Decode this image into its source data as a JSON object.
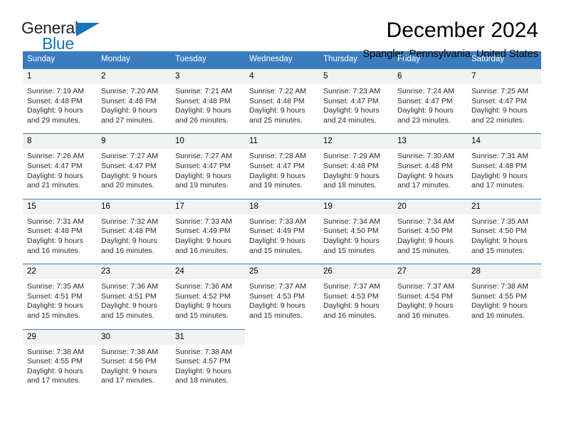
{
  "logo": {
    "word_one": "General",
    "word_two": "Blue",
    "triangle_color": "#1574bb"
  },
  "header": {
    "title": "December 2024",
    "location": "Spangler, Pennsylvania, United States"
  },
  "theme": {
    "header_blue": "#3b7cbf",
    "daynum_gray": "#f2f2f2",
    "text_black": "#000000"
  },
  "calendar": {
    "weekdays": [
      "Sunday",
      "Monday",
      "Tuesday",
      "Wednesday",
      "Thursday",
      "Friday",
      "Saturday"
    ],
    "weeks": [
      [
        {
          "day": "1",
          "sunrise": "Sunrise: 7:19 AM",
          "sunset": "Sunset: 4:48 PM",
          "daylight_1": "Daylight: 9 hours",
          "daylight_2": "and 29 minutes."
        },
        {
          "day": "2",
          "sunrise": "Sunrise: 7:20 AM",
          "sunset": "Sunset: 4:48 PM",
          "daylight_1": "Daylight: 9 hours",
          "daylight_2": "and 27 minutes."
        },
        {
          "day": "3",
          "sunrise": "Sunrise: 7:21 AM",
          "sunset": "Sunset: 4:48 PM",
          "daylight_1": "Daylight: 9 hours",
          "daylight_2": "and 26 minutes."
        },
        {
          "day": "4",
          "sunrise": "Sunrise: 7:22 AM",
          "sunset": "Sunset: 4:48 PM",
          "daylight_1": "Daylight: 9 hours",
          "daylight_2": "and 25 minutes."
        },
        {
          "day": "5",
          "sunrise": "Sunrise: 7:23 AM",
          "sunset": "Sunset: 4:47 PM",
          "daylight_1": "Daylight: 9 hours",
          "daylight_2": "and 24 minutes."
        },
        {
          "day": "6",
          "sunrise": "Sunrise: 7:24 AM",
          "sunset": "Sunset: 4:47 PM",
          "daylight_1": "Daylight: 9 hours",
          "daylight_2": "and 23 minutes."
        },
        {
          "day": "7",
          "sunrise": "Sunrise: 7:25 AM",
          "sunset": "Sunset: 4:47 PM",
          "daylight_1": "Daylight: 9 hours",
          "daylight_2": "and 22 minutes."
        }
      ],
      [
        {
          "day": "8",
          "sunrise": "Sunrise: 7:26 AM",
          "sunset": "Sunset: 4:47 PM",
          "daylight_1": "Daylight: 9 hours",
          "daylight_2": "and 21 minutes."
        },
        {
          "day": "9",
          "sunrise": "Sunrise: 7:27 AM",
          "sunset": "Sunset: 4:47 PM",
          "daylight_1": "Daylight: 9 hours",
          "daylight_2": "and 20 minutes."
        },
        {
          "day": "10",
          "sunrise": "Sunrise: 7:27 AM",
          "sunset": "Sunset: 4:47 PM",
          "daylight_1": "Daylight: 9 hours",
          "daylight_2": "and 19 minutes."
        },
        {
          "day": "11",
          "sunrise": "Sunrise: 7:28 AM",
          "sunset": "Sunset: 4:47 PM",
          "daylight_1": "Daylight: 9 hours",
          "daylight_2": "and 19 minutes."
        },
        {
          "day": "12",
          "sunrise": "Sunrise: 7:29 AM",
          "sunset": "Sunset: 4:48 PM",
          "daylight_1": "Daylight: 9 hours",
          "daylight_2": "and 18 minutes."
        },
        {
          "day": "13",
          "sunrise": "Sunrise: 7:30 AM",
          "sunset": "Sunset: 4:48 PM",
          "daylight_1": "Daylight: 9 hours",
          "daylight_2": "and 17 minutes."
        },
        {
          "day": "14",
          "sunrise": "Sunrise: 7:31 AM",
          "sunset": "Sunset: 4:48 PM",
          "daylight_1": "Daylight: 9 hours",
          "daylight_2": "and 17 minutes."
        }
      ],
      [
        {
          "day": "15",
          "sunrise": "Sunrise: 7:31 AM",
          "sunset": "Sunset: 4:48 PM",
          "daylight_1": "Daylight: 9 hours",
          "daylight_2": "and 16 minutes."
        },
        {
          "day": "16",
          "sunrise": "Sunrise: 7:32 AM",
          "sunset": "Sunset: 4:48 PM",
          "daylight_1": "Daylight: 9 hours",
          "daylight_2": "and 16 minutes."
        },
        {
          "day": "17",
          "sunrise": "Sunrise: 7:33 AM",
          "sunset": "Sunset: 4:49 PM",
          "daylight_1": "Daylight: 9 hours",
          "daylight_2": "and 16 minutes."
        },
        {
          "day": "18",
          "sunrise": "Sunrise: 7:33 AM",
          "sunset": "Sunset: 4:49 PM",
          "daylight_1": "Daylight: 9 hours",
          "daylight_2": "and 15 minutes."
        },
        {
          "day": "19",
          "sunrise": "Sunrise: 7:34 AM",
          "sunset": "Sunset: 4:50 PM",
          "daylight_1": "Daylight: 9 hours",
          "daylight_2": "and 15 minutes."
        },
        {
          "day": "20",
          "sunrise": "Sunrise: 7:34 AM",
          "sunset": "Sunset: 4:50 PM",
          "daylight_1": "Daylight: 9 hours",
          "daylight_2": "and 15 minutes."
        },
        {
          "day": "21",
          "sunrise": "Sunrise: 7:35 AM",
          "sunset": "Sunset: 4:50 PM",
          "daylight_1": "Daylight: 9 hours",
          "daylight_2": "and 15 minutes."
        }
      ],
      [
        {
          "day": "22",
          "sunrise": "Sunrise: 7:35 AM",
          "sunset": "Sunset: 4:51 PM",
          "daylight_1": "Daylight: 9 hours",
          "daylight_2": "and 15 minutes."
        },
        {
          "day": "23",
          "sunrise": "Sunrise: 7:36 AM",
          "sunset": "Sunset: 4:51 PM",
          "daylight_1": "Daylight: 9 hours",
          "daylight_2": "and 15 minutes."
        },
        {
          "day": "24",
          "sunrise": "Sunrise: 7:36 AM",
          "sunset": "Sunset: 4:52 PM",
          "daylight_1": "Daylight: 9 hours",
          "daylight_2": "and 15 minutes."
        },
        {
          "day": "25",
          "sunrise": "Sunrise: 7:37 AM",
          "sunset": "Sunset: 4:53 PM",
          "daylight_1": "Daylight: 9 hours",
          "daylight_2": "and 15 minutes."
        },
        {
          "day": "26",
          "sunrise": "Sunrise: 7:37 AM",
          "sunset": "Sunset: 4:53 PM",
          "daylight_1": "Daylight: 9 hours",
          "daylight_2": "and 16 minutes."
        },
        {
          "day": "27",
          "sunrise": "Sunrise: 7:37 AM",
          "sunset": "Sunset: 4:54 PM",
          "daylight_1": "Daylight: 9 hours",
          "daylight_2": "and 16 minutes."
        },
        {
          "day": "28",
          "sunrise": "Sunrise: 7:38 AM",
          "sunset": "Sunset: 4:55 PM",
          "daylight_1": "Daylight: 9 hours",
          "daylight_2": "and 16 minutes."
        }
      ],
      [
        {
          "day": "29",
          "sunrise": "Sunrise: 7:38 AM",
          "sunset": "Sunset: 4:55 PM",
          "daylight_1": "Daylight: 9 hours",
          "daylight_2": "and 17 minutes."
        },
        {
          "day": "30",
          "sunrise": "Sunrise: 7:38 AM",
          "sunset": "Sunset: 4:56 PM",
          "daylight_1": "Daylight: 9 hours",
          "daylight_2": "and 17 minutes."
        },
        {
          "day": "31",
          "sunrise": "Sunrise: 7:38 AM",
          "sunset": "Sunset: 4:57 PM",
          "daylight_1": "Daylight: 9 hours",
          "daylight_2": "and 18 minutes."
        },
        null,
        null,
        null,
        null
      ]
    ]
  }
}
